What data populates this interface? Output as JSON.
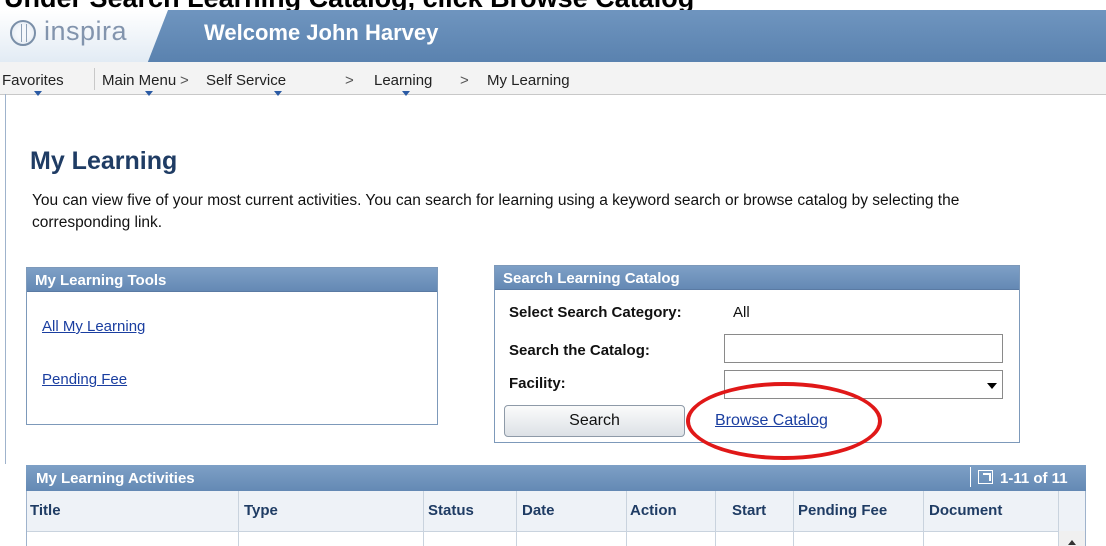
{
  "caption": "Under Search Learning Catalog, click Browse Catalog",
  "header": {
    "logo_text": "inspira",
    "welcome": "Welcome John Harvey"
  },
  "nav": {
    "favorites": "Favorites",
    "main_menu": "Main Menu",
    "self_service": "Self Service",
    "learning": "Learning",
    "my_learning": "My Learning",
    "separator": ">"
  },
  "page": {
    "title": "My Learning",
    "description": "You can view five of your most current activities. You can search for learning using a keyword search or browse catalog by selecting the corresponding link."
  },
  "tools": {
    "header": "My Learning Tools",
    "links": [
      "All My Learning",
      "Pending Fee"
    ]
  },
  "search": {
    "header": "Search Learning Catalog",
    "category_label": "Select Search Category:",
    "category_value": "All",
    "catalog_label": "Search the Catalog:",
    "catalog_value": "",
    "facility_label": "Facility:",
    "facility_value": "",
    "search_button": "Search",
    "browse_link": "Browse Catalog"
  },
  "activities": {
    "header": "My Learning Activities",
    "pagination": "1-11 of 11",
    "columns": [
      "Title",
      "Type",
      "Status",
      "Date",
      "Action",
      "Start",
      "Pending Fee",
      "Document"
    ]
  },
  "colors": {
    "header_blue": "#5a82af",
    "title_navy": "#1f3c64",
    "link_blue": "#1a3ea0",
    "highlight_red": "#e01818"
  }
}
